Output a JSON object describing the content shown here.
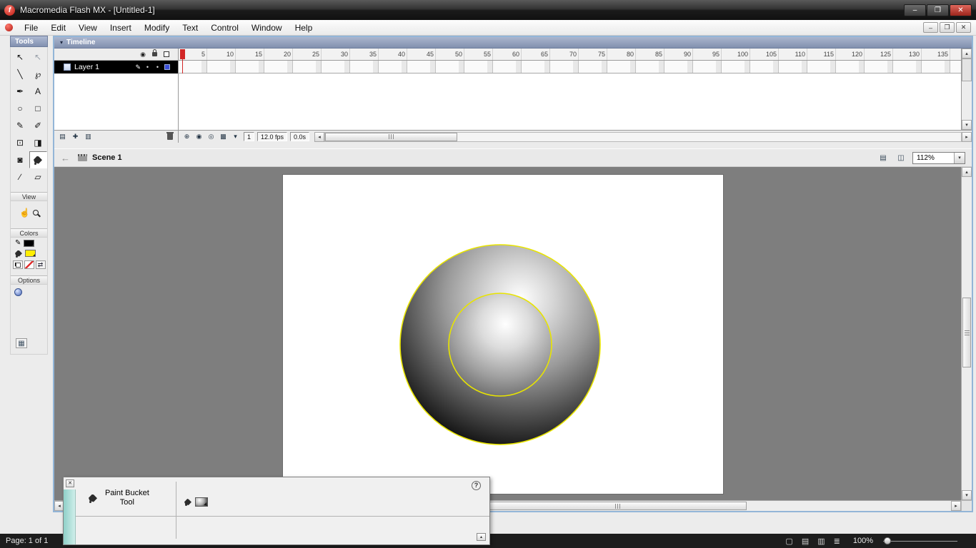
{
  "window": {
    "title": "Macromedia Flash MX - [Untitled-1]"
  },
  "menu": {
    "items": [
      "File",
      "Edit",
      "View",
      "Insert",
      "Modify",
      "Text",
      "Control",
      "Window",
      "Help"
    ]
  },
  "tools": {
    "title": "Tools",
    "sections": {
      "view": "View",
      "colors": "Colors",
      "options": "Options"
    },
    "grid": [
      {
        "name": "arrow-tool",
        "glyph": "↖"
      },
      {
        "name": "subselection-tool",
        "glyph": "↖",
        "style": "light"
      },
      {
        "name": "line-tool",
        "glyph": "╲"
      },
      {
        "name": "lasso-tool",
        "glyph": "℘"
      },
      {
        "name": "pen-tool",
        "glyph": "✒"
      },
      {
        "name": "text-tool",
        "glyph": "A"
      },
      {
        "name": "oval-tool",
        "glyph": "○"
      },
      {
        "name": "rectangle-tool",
        "glyph": "□"
      },
      {
        "name": "pencil-tool",
        "glyph": "✎"
      },
      {
        "name": "brush-tool",
        "glyph": "✐"
      },
      {
        "name": "free-transform-tool",
        "glyph": "⊡"
      },
      {
        "name": "fill-transform-tool",
        "glyph": "◨"
      },
      {
        "name": "ink-bottle-tool",
        "glyph": "◙"
      },
      {
        "name": "paint-bucket-tool",
        "glyph": "",
        "selected": true,
        "bucket": true
      },
      {
        "name": "eyedropper-tool",
        "glyph": "∕"
      },
      {
        "name": "eraser-tool",
        "glyph": "▱"
      }
    ]
  },
  "timeline": {
    "title": "Timeline",
    "layer_name": "Layer 1",
    "ruler_ticks": [
      "5",
      "10",
      "15",
      "20",
      "25",
      "30",
      "35",
      "40",
      "45",
      "50",
      "55",
      "60",
      "65",
      "70",
      "75",
      "80",
      "85",
      "90",
      "95",
      "100",
      "105",
      "110",
      "115",
      "120",
      "125",
      "130",
      "135"
    ],
    "current_frame": "1",
    "frame_rate": "12.0 fps",
    "elapsed_time": "0.0s"
  },
  "scene": {
    "name": "Scene 1",
    "zoom": "112%"
  },
  "properties": {
    "tool_name_line1": "Paint Bucket",
    "tool_name_line2": "Tool",
    "help": "?"
  },
  "viewer": {
    "page_status": "Page: 1 of 1",
    "zoom": "100%",
    "icons": [
      {
        "name": "page-single-icon",
        "glyph": "▢"
      },
      {
        "name": "page-facing-icon",
        "glyph": "▤"
      },
      {
        "name": "page-continuous-icon",
        "glyph": "▥"
      },
      {
        "name": "page-thumbnails-icon",
        "glyph": "≣"
      }
    ]
  },
  "icons": {
    "app_letter": "f",
    "minimize": "–",
    "restore": "❐",
    "close": "✕",
    "collapse_triangle": "▾",
    "eye": "◉",
    "pencil": "✎",
    "dot": "•",
    "back_arrow": "←",
    "dropdown_arrow": "▾",
    "scroll_up": "▴",
    "scroll_down": "▾",
    "scroll_left": "◂",
    "scroll_right": "▸",
    "insert_layer": "▤",
    "motion_guide": "✚",
    "layer_folder": "▥",
    "center_frame": "⊕",
    "onion_skin": "◉",
    "onion_outline": "◎",
    "edit_frames": "▩",
    "modify_markers": "▾",
    "edit_scene": "▤",
    "edit_symbols": "◫",
    "hand": "☝",
    "swap": "⇄",
    "expander": "▴"
  }
}
